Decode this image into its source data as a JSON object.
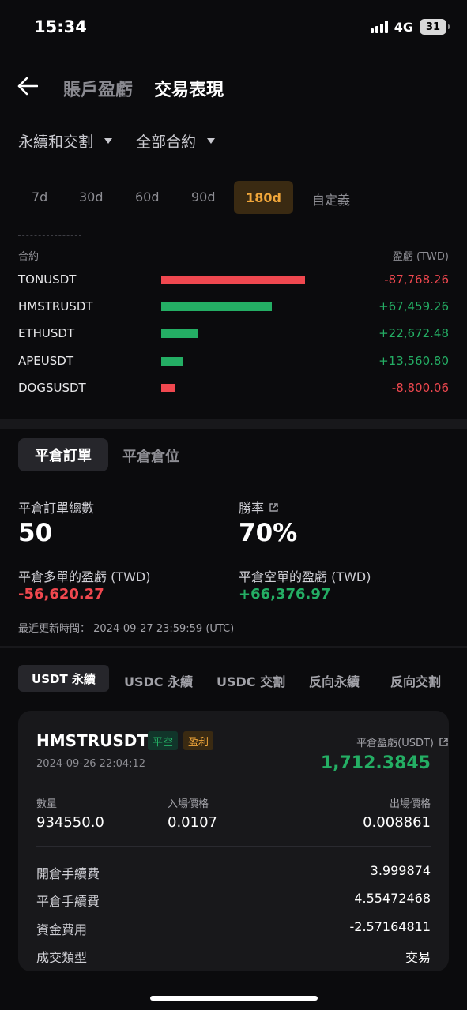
{
  "status_bar": {
    "time": "15:34",
    "network": "4G",
    "battery": "31"
  },
  "header": {
    "tab_inactive": "賬戶盈虧",
    "tab_active": "交易表現"
  },
  "filters": {
    "contract_type": "永續和交割",
    "contract_scope": "全部合約"
  },
  "periods": [
    "7d",
    "30d",
    "60d",
    "90d",
    "180d",
    "自定義"
  ],
  "selected_period": "180d",
  "pnl_list": {
    "col_symbol": "合約",
    "col_pnl": "盈虧 (TWD)",
    "rows": [
      {
        "symbol": "TONUSDT",
        "value": "-87,768.26",
        "amount": -87768.26
      },
      {
        "symbol": "HMSTRUSDT",
        "value": "+67,459.26",
        "amount": 67459.26
      },
      {
        "symbol": "ETHUSDT",
        "value": "+22,672.48",
        "amount": 22672.48
      },
      {
        "symbol": "APEUSDT",
        "value": "+13,560.80",
        "amount": 13560.8
      },
      {
        "symbol": "DOGSUSDT",
        "value": "-8,800.06",
        "amount": -8800.06
      }
    ]
  },
  "close": {
    "tab_orders": "平倉訂單",
    "tab_positions": "平倉倉位",
    "total_orders_label": "平倉訂單總數",
    "total_orders": "50",
    "win_rate_label": "勝率",
    "win_rate": "70%",
    "long_pnl_label": "平倉多單的盈虧 (TWD)",
    "long_pnl": "-56,620.27",
    "short_pnl_label": "平倉空單的盈虧 (TWD)",
    "short_pnl": "+66,376.97",
    "updated": "最近更新時間： 2024-09-27 23:59:59 (UTC)"
  },
  "product_tabs": [
    "USDT 永續",
    "USDC 永續",
    "USDC 交割",
    "反向永續",
    "反向交割"
  ],
  "card": {
    "symbol": "HMSTRUSDT",
    "side_badge": "平空",
    "result_badge": "盈利",
    "date": "2024-09-26 22:04:12",
    "pnl_label": "平倉盈虧(USDT)",
    "pnl_value": "1,712.3845",
    "qty_label": "數量",
    "qty": "934550.0",
    "entry_label": "入場價格",
    "entry": "0.0107",
    "exit_label": "出場價格",
    "exit": "0.008861",
    "fees": [
      {
        "label": "開倉手續費",
        "value": "3.999874"
      },
      {
        "label": "平倉手續費",
        "value": "4.55472468"
      },
      {
        "label": "資金費用",
        "value": "-2.57164811"
      },
      {
        "label": "成交類型",
        "value": "交易"
      }
    ]
  },
  "colors": {
    "loss": "#f0484f",
    "profit": "#24ae64",
    "accent": "#f0a63a"
  }
}
